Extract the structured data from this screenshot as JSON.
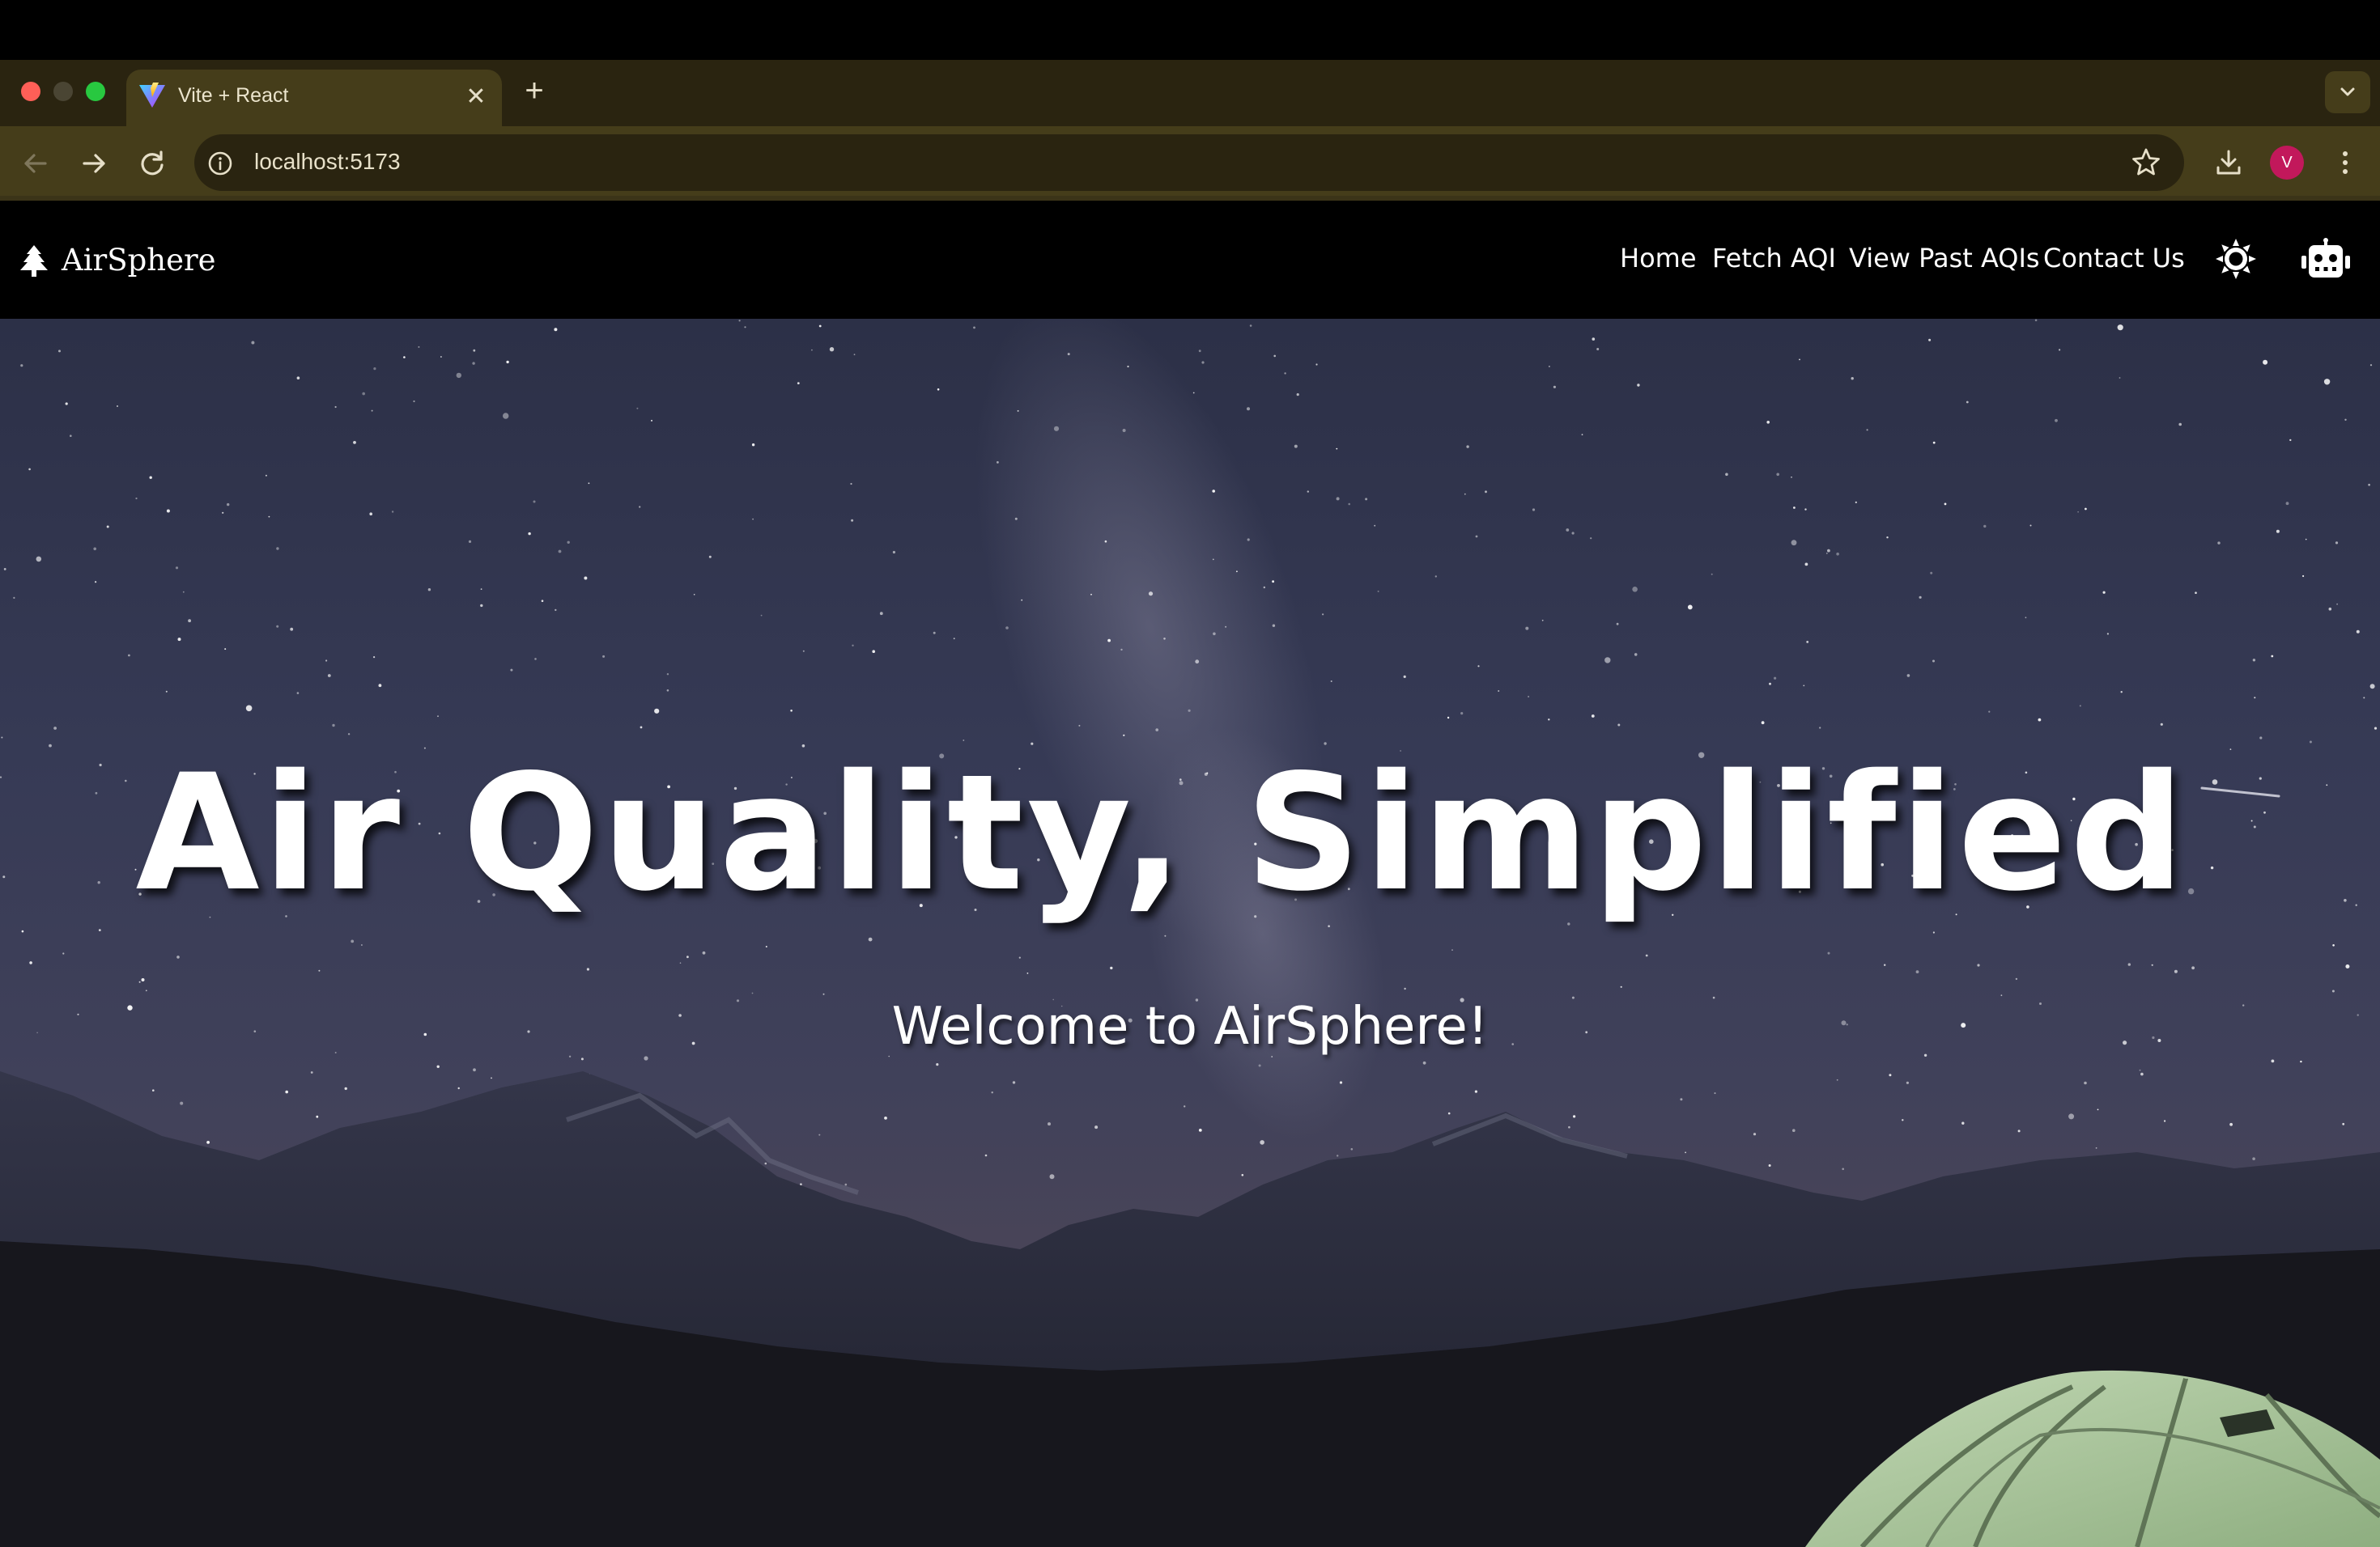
{
  "browser": {
    "tab": {
      "title": "Vite + React"
    },
    "address_bar": {
      "url": "localhost:5173"
    },
    "profile_initial": "V"
  },
  "site": {
    "logo_text": "AirSphere",
    "nav": [
      {
        "label": "Home"
      },
      {
        "label": "Fetch AQI"
      },
      {
        "label": "View Past AQIs"
      },
      {
        "label": "Contact Us"
      }
    ]
  },
  "hero": {
    "title": "Air Quality, Simplified",
    "subtitle": "Welcome to AirSphere!"
  },
  "colors": {
    "browser_frame": "#453d1a",
    "tab_strip": "#2a2410",
    "header_bg": "#000000",
    "hero_text": "#ffffff",
    "tent_green": "#a9c49c"
  }
}
